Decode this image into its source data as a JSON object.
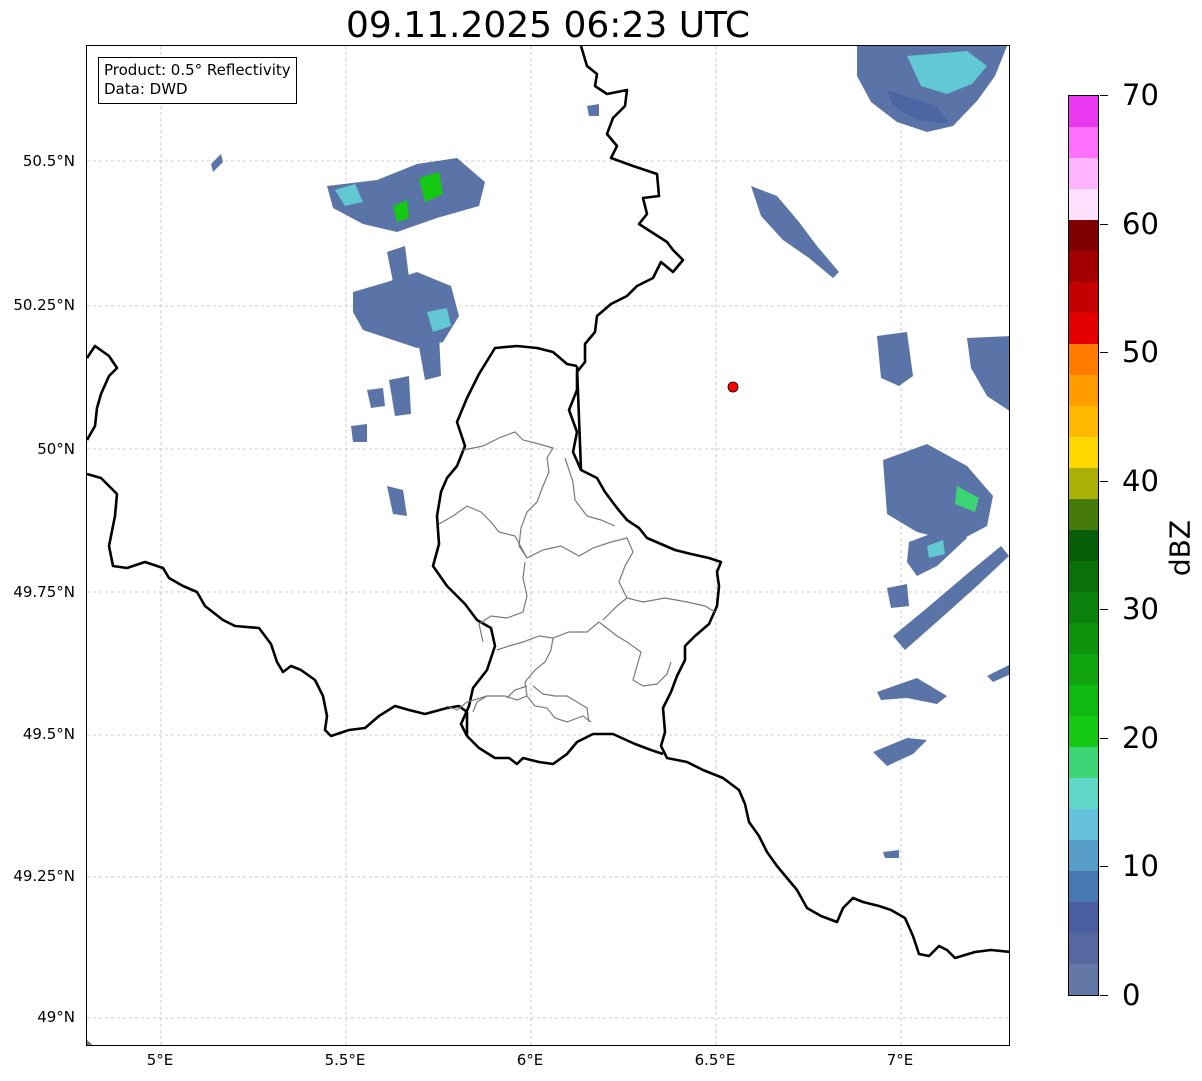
{
  "title": "09.11.2025 06:23 UTC",
  "info_box": {
    "product": "Product: 0.5° Reflectivity",
    "source": "Data: DWD"
  },
  "lat_labels": [
    "50.5°N",
    "50.25°N",
    "50°N",
    "49.75°N",
    "49.5°N",
    "49.25°N",
    "49°N"
  ],
  "lon_labels": [
    "5°E",
    "5.5°E",
    "6°E",
    "6.5°E",
    "7°E"
  ],
  "map": {
    "extent": {
      "lon_min": 4.8,
      "lon_max": 7.3,
      "lat_min": 48.95,
      "lat_max": 50.7
    },
    "gridlines": true,
    "marker": {
      "lon": 6.55,
      "lat": 50.11,
      "color": "#ff0000"
    }
  },
  "colorbar": {
    "unit_label": "dBZ",
    "min": 0,
    "max": 70,
    "tick_labels": [
      "0",
      "10",
      "20",
      "30",
      "40",
      "50",
      "60",
      "70"
    ],
    "colors": [
      "#6478a8",
      "#5668a0",
      "#4a5ea0",
      "#4778b0",
      "#589cc8",
      "#66c2dc",
      "#60d6c6",
      "#3cd474",
      "#14c814",
      "#12b812",
      "#10a410",
      "#0e920e",
      "#0c800c",
      "#0a700a",
      "#085e08",
      "#467a0a",
      "#aab004",
      "#ffd800",
      "#ffba00",
      "#ff9c00",
      "#ff7c00",
      "#e40000",
      "#c40000",
      "#a20000",
      "#800000",
      "#ffe0ff",
      "#ffb4ff",
      "#ff70ff",
      "#e838f0"
    ]
  }
}
